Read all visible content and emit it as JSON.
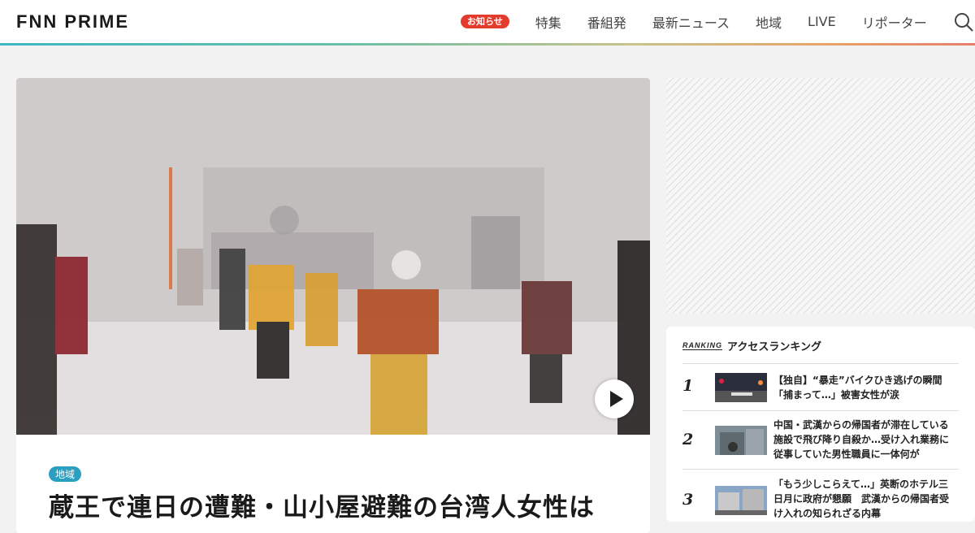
{
  "header": {
    "logo": "FNN PRIME",
    "notice_badge": "お知らせ",
    "nav": [
      "特集",
      "番組発",
      "最新ニュース",
      "地域",
      "LIVE",
      "リポーター"
    ]
  },
  "hero": {
    "category": "地域",
    "headline": "蔵王で連日の遭難・山小屋避難の台湾人女性は"
  },
  "ranking": {
    "logo": "RANKING",
    "title": "アクセスランキング",
    "items": [
      {
        "rank": "1",
        "text": "【独自】“暴走”バイクひき逃げの瞬間　「捕まって…」被害女性が涙"
      },
      {
        "rank": "2",
        "text": "中国・武漢からの帰国者が滞在している施設で飛び降り自殺か…受け入れ業務に従事していた男性職員に一体何が"
      },
      {
        "rank": "3",
        "text": "「もう少しこらえて…」英断のホテル三日月に政府が懇願　武漢からの帰国者受け入れの知られざる内幕"
      }
    ]
  },
  "colors": {
    "accent": "#e53b2c",
    "tag": "#2a9fc2",
    "stripe": [
      "#3bb6c4",
      "#e67f6a"
    ]
  }
}
